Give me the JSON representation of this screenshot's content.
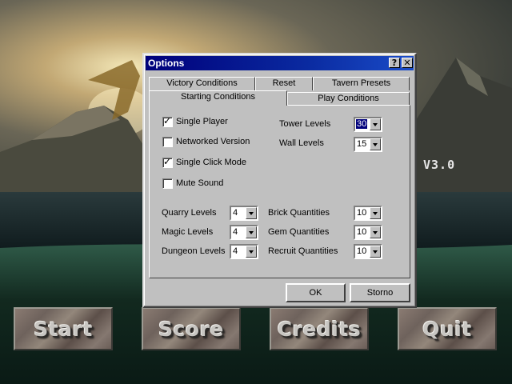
{
  "version_label": "V3.0",
  "menu": {
    "start": "Start",
    "score": "Score",
    "credits": "Credits",
    "quit": "Quit"
  },
  "dialog": {
    "title": "Options",
    "help_glyph": "?",
    "close_glyph": "✕",
    "tabs": {
      "victory": "Victory Conditions",
      "reset": "Reset",
      "tavern": "Tavern Presets",
      "starting": "Starting Conditions",
      "play": "Play Conditions"
    },
    "checkboxes": {
      "single_player": {
        "label": "Single Player",
        "checked": true,
        "mark": "✓"
      },
      "networked": {
        "label": "Networked Version",
        "checked": false,
        "mark": ""
      },
      "single_click": {
        "label": "Single Click Mode",
        "checked": true,
        "mark": "✓"
      },
      "mute": {
        "label": "Mute Sound",
        "checked": false,
        "mark": ""
      }
    },
    "fields": {
      "tower_levels": {
        "label": "Tower Levels",
        "value": "30"
      },
      "wall_levels": {
        "label": "Wall Levels",
        "value": "15"
      },
      "quarry_levels": {
        "label": "Quarry Levels",
        "value": "4"
      },
      "magic_levels": {
        "label": "Magic Levels",
        "value": "4"
      },
      "dungeon_levels": {
        "label": "Dungeon Levels",
        "value": "4"
      },
      "brick_quantities": {
        "label": "Brick Quantities",
        "value": "10"
      },
      "gem_quantities": {
        "label": "Gem Quantities",
        "value": "10"
      },
      "recruit_quantities": {
        "label": "Recruit Quantities",
        "value": "10"
      }
    },
    "ok_label": "OK",
    "cancel_label": "Storno"
  }
}
